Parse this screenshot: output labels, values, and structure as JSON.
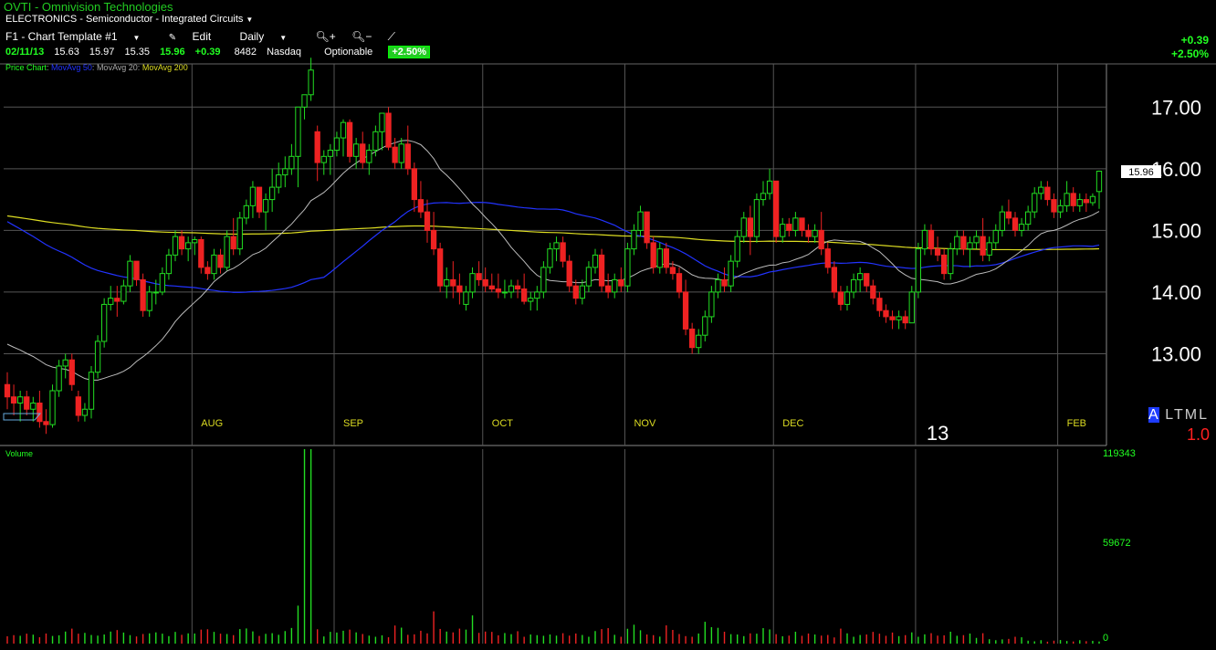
{
  "header": {
    "title": "OVTI - Omnivision Technologies",
    "sector": "ELECTRONICS - Semiconductor - Integrated Circuits",
    "template": "F1 - Chart Template #1",
    "edit_label": "Edit",
    "period": "Daily",
    "zoom_in_icon": "zoom-in-icon",
    "zoom_out_icon": "zoom-out-icon",
    "draw_icon": "pencil-icon"
  },
  "quote": {
    "date": "02/11/13",
    "open": "15.63",
    "high": "15.97",
    "low": "15.35",
    "close": "15.96",
    "change": "+0.39",
    "volume": "8482",
    "exchange": "Nasdaq",
    "optionable": "Optionable",
    "pct": "+2.50%"
  },
  "legend": {
    "price": "Price Chart",
    "ma50": "MovAvg 50",
    "ma20": "MovAvg 20",
    "ma200": "MovAvg 200",
    "sep": ":"
  },
  "corner": {
    "change": "+0.39",
    "pct": "+2.50%"
  },
  "toggles": {
    "a": "A",
    "rest": "LTML",
    "scale": "1.0"
  },
  "colors": {
    "up": "#22dd22",
    "down": "#ee2222",
    "ma50": "#2233ff",
    "ma20": "#bbbbbb",
    "ma200": "#dddd22",
    "grid": "#555555",
    "month": "#dddd22"
  },
  "chart_data": {
    "type": "candlestick",
    "ylim": [
      12.0,
      17.7
    ],
    "y_ticks": [
      "17.00",
      "16.00",
      "15.00",
      "14.00",
      "13.00"
    ],
    "y_tick_values": [
      17,
      16,
      15,
      14,
      13
    ],
    "last_price_label": "15.96",
    "month_labels": [
      "AUG",
      "SEP",
      "OCT",
      "NOV",
      "DEC",
      "13",
      "FEB"
    ],
    "volume_ticks": [
      "119343",
      "59672",
      "0"
    ],
    "volume_max": 119343,
    "volume_label": "Volume",
    "candles": [
      [
        12.5,
        12.7,
        12.1,
        12.3
      ],
      [
        12.3,
        12.5,
        12.0,
        12.2
      ],
      [
        12.2,
        12.4,
        11.9,
        12.3
      ],
      [
        12.3,
        12.4,
        12.0,
        12.1
      ],
      [
        12.1,
        12.3,
        11.9,
        12.2
      ],
      [
        12.2,
        12.4,
        11.8,
        11.9
      ],
      [
        11.9,
        12.1,
        11.7,
        11.85
      ],
      [
        11.85,
        12.5,
        11.8,
        12.4
      ],
      [
        12.4,
        12.9,
        12.3,
        12.8
      ],
      [
        12.8,
        13.0,
        12.6,
        12.9
      ],
      [
        12.9,
        13.0,
        12.4,
        12.5
      ],
      [
        12.3,
        12.4,
        11.9,
        12.0
      ],
      [
        12.0,
        12.2,
        11.9,
        12.1
      ],
      [
        12.1,
        12.8,
        11.95,
        12.7
      ],
      [
        12.7,
        13.3,
        12.6,
        13.2
      ],
      [
        13.2,
        13.9,
        13.1,
        13.8
      ],
      [
        13.8,
        14.1,
        13.7,
        13.9
      ],
      [
        13.9,
        14.1,
        13.6,
        13.85
      ],
      [
        13.85,
        14.2,
        13.8,
        14.1
      ],
      [
        14.1,
        14.6,
        14.0,
        14.5
      ],
      [
        14.5,
        14.2,
        14.1,
        14.2
      ],
      [
        14.2,
        14.3,
        13.6,
        13.7
      ],
      [
        13.7,
        14.1,
        13.6,
        14.0
      ],
      [
        14.0,
        14.2,
        13.8,
        14.0
      ],
      [
        14.0,
        14.4,
        13.95,
        14.3
      ],
      [
        14.3,
        14.7,
        14.2,
        14.6
      ],
      [
        14.6,
        15.0,
        14.5,
        14.9
      ],
      [
        14.9,
        15.0,
        14.6,
        14.7
      ],
      [
        14.7,
        14.9,
        14.5,
        14.8
      ],
      [
        14.8,
        14.9,
        14.6,
        14.85
      ],
      [
        14.85,
        14.9,
        14.3,
        14.4
      ],
      [
        14.4,
        14.5,
        14.2,
        14.3
      ],
      [
        14.3,
        14.7,
        14.2,
        14.6
      ],
      [
        14.6,
        14.7,
        14.3,
        14.4
      ],
      [
        14.4,
        15.0,
        14.35,
        14.9
      ],
      [
        14.9,
        15.2,
        14.6,
        14.7
      ],
      [
        14.7,
        15.3,
        14.6,
        15.2
      ],
      [
        15.2,
        15.5,
        15.1,
        15.4
      ],
      [
        15.4,
        15.8,
        15.2,
        15.7
      ],
      [
        15.7,
        15.7,
        15.2,
        15.3
      ],
      [
        15.3,
        15.6,
        15.0,
        15.5
      ],
      [
        15.5,
        16.0,
        15.3,
        15.7
      ],
      [
        15.7,
        16.1,
        15.6,
        15.9
      ],
      [
        15.9,
        16.2,
        15.7,
        16.0
      ],
      [
        16.0,
        16.4,
        15.9,
        16.2
      ],
      [
        16.2,
        17.0,
        15.7,
        17.0
      ],
      [
        17.0,
        17.2,
        16.8,
        17.2
      ],
      [
        17.2,
        17.8,
        17.1,
        17.6
      ],
      [
        16.6,
        16.7,
        15.8,
        16.1
      ],
      [
        16.1,
        16.3,
        15.9,
        16.2
      ],
      [
        16.2,
        16.4,
        15.9,
        16.3
      ],
      [
        16.3,
        16.6,
        16.2,
        16.5
      ],
      [
        16.5,
        16.8,
        16.2,
        16.75
      ],
      [
        16.75,
        16.8,
        16.1,
        16.2
      ],
      [
        16.2,
        16.5,
        16.0,
        16.4
      ],
      [
        16.4,
        16.6,
        16.0,
        16.1
      ],
      [
        16.1,
        16.4,
        15.9,
        16.3
      ],
      [
        16.3,
        16.7,
        16.2,
        16.6
      ],
      [
        16.6,
        16.9,
        16.3,
        16.9
      ],
      [
        16.9,
        17.0,
        16.3,
        16.35
      ],
      [
        16.35,
        16.5,
        16.0,
        16.1
      ],
      [
        16.1,
        16.5,
        16.0,
        16.4
      ],
      [
        16.4,
        16.7,
        15.9,
        16.0
      ],
      [
        16.0,
        16.1,
        15.3,
        15.5
      ],
      [
        15.5,
        15.8,
        15.2,
        15.3
      ],
      [
        15.3,
        15.5,
        14.8,
        15.0
      ],
      [
        15.0,
        15.3,
        14.6,
        14.7
      ],
      [
        14.7,
        14.8,
        14.0,
        14.1
      ],
      [
        14.1,
        14.4,
        13.9,
        14.2
      ],
      [
        14.2,
        14.5,
        13.9,
        14.1
      ],
      [
        14.1,
        14.3,
        13.8,
        14.0
      ],
      [
        13.8,
        14.1,
        13.7,
        14.0
      ],
      [
        14.0,
        14.4,
        13.9,
        14.3
      ],
      [
        14.3,
        14.5,
        14.1,
        14.2
      ],
      [
        14.2,
        14.4,
        14.0,
        14.1
      ],
      [
        14.1,
        14.3,
        14.0,
        14.05
      ],
      [
        14.05,
        14.3,
        13.9,
        14.0
      ],
      [
        14.0,
        14.2,
        13.9,
        14.0
      ],
      [
        14.0,
        14.2,
        13.9,
        14.1
      ],
      [
        14.1,
        14.2,
        13.9,
        14.05
      ],
      [
        14.05,
        14.3,
        13.8,
        13.85
      ],
      [
        13.85,
        14.0,
        13.7,
        13.9
      ],
      [
        13.9,
        14.1,
        13.7,
        14.0
      ],
      [
        14.0,
        14.5,
        13.9,
        14.4
      ],
      [
        14.4,
        14.8,
        14.3,
        14.7
      ],
      [
        14.7,
        14.9,
        14.5,
        14.8
      ],
      [
        14.8,
        14.9,
        14.4,
        14.5
      ],
      [
        14.5,
        14.6,
        14.0,
        14.1
      ],
      [
        14.1,
        14.2,
        13.8,
        13.9
      ],
      [
        13.9,
        14.2,
        13.8,
        14.1
      ],
      [
        14.1,
        14.5,
        14.0,
        14.4
      ],
      [
        14.4,
        14.7,
        14.3,
        14.6
      ],
      [
        14.6,
        14.7,
        14.0,
        14.1
      ],
      [
        14.1,
        14.3,
        13.9,
        14.0
      ],
      [
        14.0,
        14.3,
        13.9,
        14.2
      ],
      [
        14.2,
        14.4,
        14.0,
        14.1
      ],
      [
        14.1,
        14.8,
        14.0,
        14.7
      ],
      [
        14.7,
        15.1,
        14.6,
        15.0
      ],
      [
        15.0,
        15.4,
        14.9,
        15.3
      ],
      [
        15.3,
        15.3,
        14.7,
        14.8
      ],
      [
        14.8,
        14.9,
        14.3,
        14.4
      ],
      [
        14.4,
        14.8,
        14.3,
        14.7
      ],
      [
        14.7,
        14.8,
        14.3,
        14.4
      ],
      [
        14.4,
        14.5,
        14.2,
        14.3
      ],
      [
        14.3,
        14.4,
        13.9,
        14.0
      ],
      [
        14.0,
        14.2,
        13.3,
        13.4
      ],
      [
        13.4,
        13.5,
        13.0,
        13.1
      ],
      [
        13.1,
        13.4,
        13.0,
        13.3
      ],
      [
        13.3,
        13.7,
        13.2,
        13.6
      ],
      [
        13.6,
        14.1,
        13.5,
        14.0
      ],
      [
        14.0,
        14.3,
        13.9,
        14.2
      ],
      [
        14.2,
        14.4,
        14.0,
        14.1
      ],
      [
        14.1,
        14.6,
        14.0,
        14.5
      ],
      [
        14.5,
        15.0,
        14.4,
        14.9
      ],
      [
        14.9,
        15.3,
        14.8,
        15.2
      ],
      [
        15.2,
        15.4,
        14.6,
        14.9
      ],
      [
        14.9,
        15.6,
        14.8,
        15.5
      ],
      [
        15.5,
        15.8,
        15.4,
        15.6
      ],
      [
        15.6,
        16.0,
        15.5,
        15.8
      ],
      [
        15.8,
        15.8,
        14.8,
        14.9
      ],
      [
        14.9,
        15.2,
        14.8,
        15.1
      ],
      [
        15.1,
        15.2,
        14.9,
        15.0
      ],
      [
        15.0,
        15.3,
        14.9,
        15.2
      ],
      [
        15.2,
        15.2,
        14.9,
        15.0
      ],
      [
        15.0,
        15.1,
        14.8,
        14.9
      ],
      [
        14.9,
        15.1,
        14.8,
        15.0
      ],
      [
        15.0,
        15.3,
        14.6,
        14.7
      ],
      [
        14.7,
        14.8,
        14.3,
        14.4
      ],
      [
        14.4,
        14.5,
        13.9,
        14.0
      ],
      [
        14.0,
        14.1,
        13.7,
        13.8
      ],
      [
        13.8,
        14.1,
        13.7,
        14.0
      ],
      [
        14.0,
        14.3,
        13.9,
        14.2
      ],
      [
        14.2,
        14.4,
        14.0,
        14.3
      ],
      [
        14.3,
        14.3,
        14.0,
        14.1
      ],
      [
        14.1,
        14.2,
        13.8,
        13.9
      ],
      [
        13.9,
        14.0,
        13.6,
        13.7
      ],
      [
        13.7,
        13.8,
        13.5,
        13.6
      ],
      [
        13.6,
        13.7,
        13.4,
        13.55
      ],
      [
        13.55,
        13.7,
        13.4,
        13.6
      ],
      [
        13.6,
        13.7,
        13.4,
        13.5
      ],
      [
        13.5,
        14.1,
        13.5,
        14.0
      ],
      [
        14.0,
        14.8,
        13.9,
        14.7
      ],
      [
        14.7,
        15.1,
        14.6,
        15.0
      ],
      [
        15.0,
        15.1,
        14.6,
        14.7
      ],
      [
        14.7,
        14.9,
        14.5,
        14.6
      ],
      [
        14.6,
        14.7,
        14.2,
        14.3
      ],
      [
        14.3,
        14.8,
        14.2,
        14.7
      ],
      [
        14.7,
        15.0,
        14.6,
        14.9
      ],
      [
        14.9,
        15.0,
        14.6,
        14.7
      ],
      [
        14.7,
        14.9,
        14.4,
        14.8
      ],
      [
        14.8,
        15.0,
        14.7,
        14.9
      ],
      [
        14.9,
        15.2,
        14.5,
        14.6
      ],
      [
        14.6,
        14.9,
        14.5,
        14.8
      ],
      [
        14.8,
        15.1,
        14.7,
        15.0
      ],
      [
        15.0,
        15.4,
        14.9,
        15.3
      ],
      [
        15.3,
        15.5,
        15.1,
        15.2
      ],
      [
        15.2,
        15.3,
        14.9,
        15.0
      ],
      [
        15.0,
        15.2,
        14.9,
        15.1
      ],
      [
        15.1,
        15.4,
        15.0,
        15.3
      ],
      [
        15.3,
        15.7,
        15.2,
        15.6
      ],
      [
        15.6,
        15.8,
        15.5,
        15.7
      ],
      [
        15.7,
        15.8,
        15.4,
        15.5
      ],
      [
        15.5,
        15.6,
        15.2,
        15.3
      ],
      [
        15.3,
        15.5,
        15.2,
        15.4
      ],
      [
        15.4,
        15.8,
        15.3,
        15.6
      ],
      [
        15.6,
        15.7,
        15.3,
        15.4
      ],
      [
        15.4,
        15.6,
        15.3,
        15.5
      ],
      [
        15.5,
        15.6,
        15.3,
        15.45
      ],
      [
        15.45,
        15.6,
        15.4,
        15.55
      ],
      [
        15.63,
        15.97,
        15.35,
        15.96
      ]
    ],
    "volume": [
      4500,
      5200,
      4800,
      6100,
      5500,
      3900,
      6200,
      4700,
      5100,
      7400,
      9200,
      6100,
      6600,
      5300,
      4900,
      5600,
      7400,
      8300,
      6800,
      5200,
      4400,
      5900,
      6300,
      6900,
      6100,
      4600,
      7200,
      5400,
      6300,
      6200,
      8600,
      8800,
      7200,
      6100,
      5900,
      5200,
      8900,
      9300,
      7500,
      4700,
      6000,
      6400,
      5400,
      7700,
      9600,
      23300,
      119343,
      119343,
      8800,
      4400,
      7200,
      6800,
      7900,
      8600,
      6900,
      5900,
      4900,
      4200,
      5100,
      3900,
      11100,
      9800,
      5400,
      5700,
      7900,
      6300,
      19800,
      9000,
      7400,
      6900,
      9200,
      8600,
      17300,
      6600,
      7400,
      7200,
      5100,
      6500,
      5800,
      7600,
      4200,
      5600,
      5200,
      4800,
      5600,
      4900,
      6400,
      4900,
      6200,
      5300,
      4200,
      7700,
      8900,
      9500,
      5400,
      4200,
      9100,
      11600,
      8200,
      5600,
      5200,
      4300,
      11200,
      8400,
      5900,
      4600,
      4200,
      6200,
      13400,
      10100,
      9700,
      7300,
      5800,
      5600,
      4600,
      6300,
      6100,
      9500,
      8700,
      5800,
      4500,
      4900,
      7300,
      4800,
      6200,
      5600,
      4900,
      5300,
      3800,
      9200,
      6300,
      4200,
      5300,
      5600,
      7200,
      6100,
      4800,
      6800,
      4600,
      5200,
      6900,
      4200,
      5700,
      6400,
      4900,
      5100,
      7300,
      4800,
      5200,
      6200,
      3500,
      6400,
      2700,
      2100,
      2600,
      2900,
      4200,
      3900,
      1800,
      1400,
      2100,
      1200,
      1800,
      2200,
      1600,
      1300,
      2100,
      1500,
      1700,
      1300,
      2600,
      2000,
      1800
    ]
  }
}
